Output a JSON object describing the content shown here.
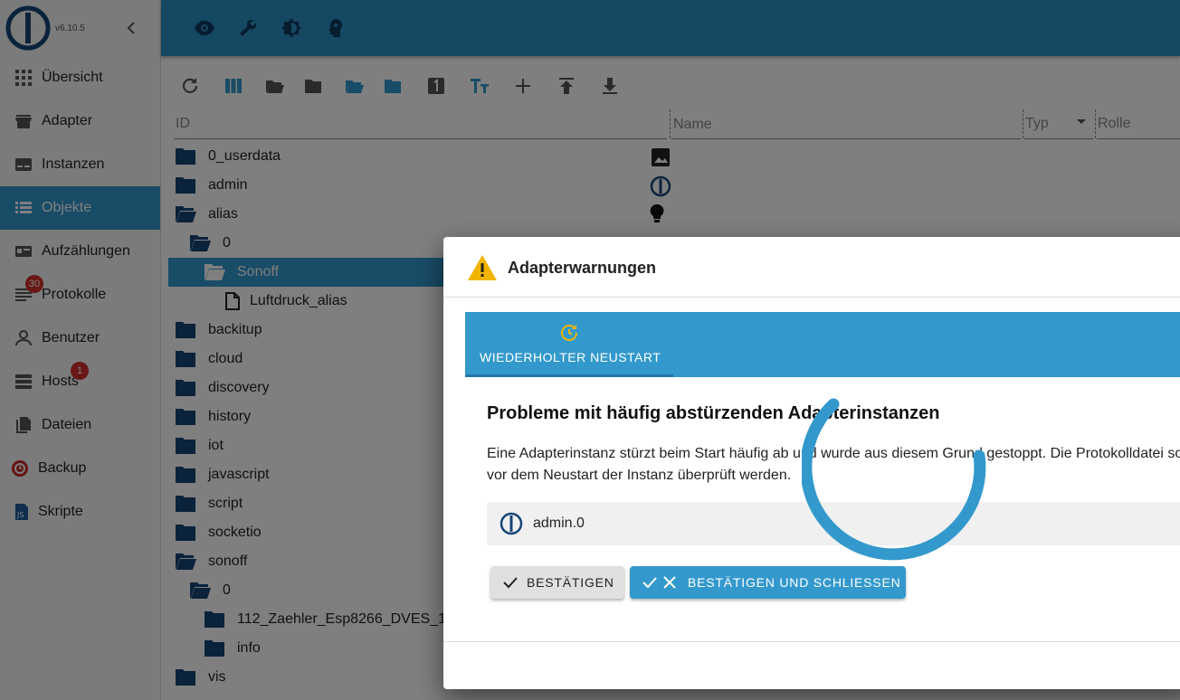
{
  "app": {
    "version": "v6.10.5"
  },
  "sidebar": {
    "items": [
      {
        "label": "Übersicht",
        "icon": "apps-icon"
      },
      {
        "label": "Adapter",
        "icon": "store-icon"
      },
      {
        "label": "Instanzen",
        "icon": "subtitles-icon"
      },
      {
        "label": "Objekte",
        "icon": "list-icon",
        "active": true
      },
      {
        "label": "Aufzählungen",
        "icon": "enum-icon"
      },
      {
        "label": "Protokolle",
        "icon": "log-icon",
        "badge": "30"
      },
      {
        "label": "Benutzer",
        "icon": "person-icon"
      },
      {
        "label": "Hosts",
        "icon": "storage-icon",
        "badge": "1"
      },
      {
        "label": "Dateien",
        "icon": "files-icon"
      },
      {
        "label": "Backup",
        "icon": "backup-icon"
      },
      {
        "label": "Skripte",
        "icon": "javascript-icon"
      }
    ]
  },
  "table": {
    "headers": {
      "id": "ID",
      "name": "Name",
      "type": "Typ",
      "role": "Rolle"
    },
    "rows": [
      {
        "label": "0_userdata",
        "icon": "folder-icon"
      },
      {
        "label": "admin",
        "icon": "folder-icon"
      },
      {
        "label": "alias",
        "icon": "folder-open-icon"
      },
      {
        "label": "0",
        "icon": "folder-open-icon"
      },
      {
        "label": "Sonoff",
        "icon": "folder-open-icon",
        "selected": true
      },
      {
        "label": "Luftdruck_alias",
        "icon": "file-icon"
      },
      {
        "label": "backitup",
        "icon": "folder-icon"
      },
      {
        "label": "cloud",
        "icon": "folder-icon"
      },
      {
        "label": "discovery",
        "icon": "folder-icon"
      },
      {
        "label": "history",
        "icon": "folder-icon"
      },
      {
        "label": "iot",
        "icon": "folder-icon"
      },
      {
        "label": "javascript",
        "icon": "folder-icon"
      },
      {
        "label": "script",
        "icon": "folder-icon"
      },
      {
        "label": "socketio",
        "icon": "folder-icon"
      },
      {
        "label": "sonoff",
        "icon": "folder-open-icon"
      },
      {
        "label": "0",
        "icon": "folder-open-icon"
      },
      {
        "label": "112_Zaehler_Esp8266_DVES_1",
        "icon": "folder-icon"
      },
      {
        "label": "info",
        "icon": "folder-icon"
      },
      {
        "label": "vis",
        "icon": "folder-icon"
      }
    ]
  },
  "dialog": {
    "title": "Adapterwarnungen",
    "tab_label": "WIEDERHOLTER NEUSTART",
    "heading": "Probleme mit häufig abstürzenden Adapterinstanzen",
    "description": "Eine Adapterinstanz stürzt beim Start häufig ab und wurde aus diesem Grund gestoppt. Die Protokolldatei sollte vor dem Neustart der Instanz überprüft werden.",
    "instance": "admin.0",
    "confirm_label": "BESTÄTIGEN",
    "confirm_close_label": "BESTÄTIGEN UND SCHLIESSEN"
  },
  "colors": {
    "accent": "#3399cc",
    "topbar": "#2b90c4",
    "warning": "#f0b400",
    "badge": "#d32f2f",
    "navy": "#164477"
  }
}
